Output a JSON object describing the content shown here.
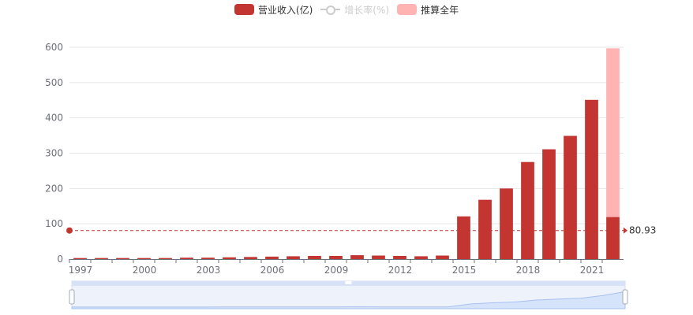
{
  "legend": {
    "items": [
      {
        "label": "营业收入(亿)",
        "color": "#c23531",
        "kind": "bar",
        "active": true
      },
      {
        "label": "增长率(%)",
        "color": "#cccccc",
        "kind": "line",
        "active": false
      },
      {
        "label": "推算全年",
        "color": "#ffb3b3",
        "kind": "bar",
        "active": true
      }
    ]
  },
  "chart_data": {
    "type": "bar",
    "categories": [
      "1997",
      "1998",
      "1999",
      "2000",
      "2001",
      "2002",
      "2003",
      "2004",
      "2005",
      "2006",
      "2007",
      "2008",
      "2009",
      "2010",
      "2011",
      "2012",
      "2013",
      "2014",
      "2015",
      "2016",
      "2017",
      "2018",
      "2019",
      "2020",
      "2021",
      "2022"
    ],
    "x_tick_labels": [
      "1997",
      "2000",
      "2003",
      "2006",
      "2009",
      "2012",
      "2015",
      "2018",
      "2021"
    ],
    "series": [
      {
        "name": "营业收入(亿)",
        "color": "#c23531",
        "values": [
          3,
          3,
          3,
          3,
          3,
          4,
          4,
          5,
          6,
          7,
          8,
          9,
          9,
          11,
          10,
          9,
          8,
          10,
          121,
          168,
          200,
          275,
          311,
          349,
          451,
          119
        ]
      },
      {
        "name": "推算全年",
        "color": "#ffb3b3",
        "values": [
          null,
          null,
          null,
          null,
          null,
          null,
          null,
          null,
          null,
          null,
          null,
          null,
          null,
          null,
          null,
          null,
          null,
          null,
          null,
          null,
          null,
          null,
          null,
          null,
          null,
          597
        ]
      }
    ],
    "ylim": [
      0,
      600
    ],
    "yticks": [
      0,
      100,
      200,
      300,
      400,
      500,
      600
    ],
    "grid": true,
    "reference_line": {
      "value": 80.93,
      "label": "80.93",
      "color": "#c23531"
    },
    "legend_position": "top-center"
  },
  "datazoom": {
    "fill": "#d6e4fb",
    "line": "#a7c0f0",
    "handle_color": "#ffffff"
  }
}
